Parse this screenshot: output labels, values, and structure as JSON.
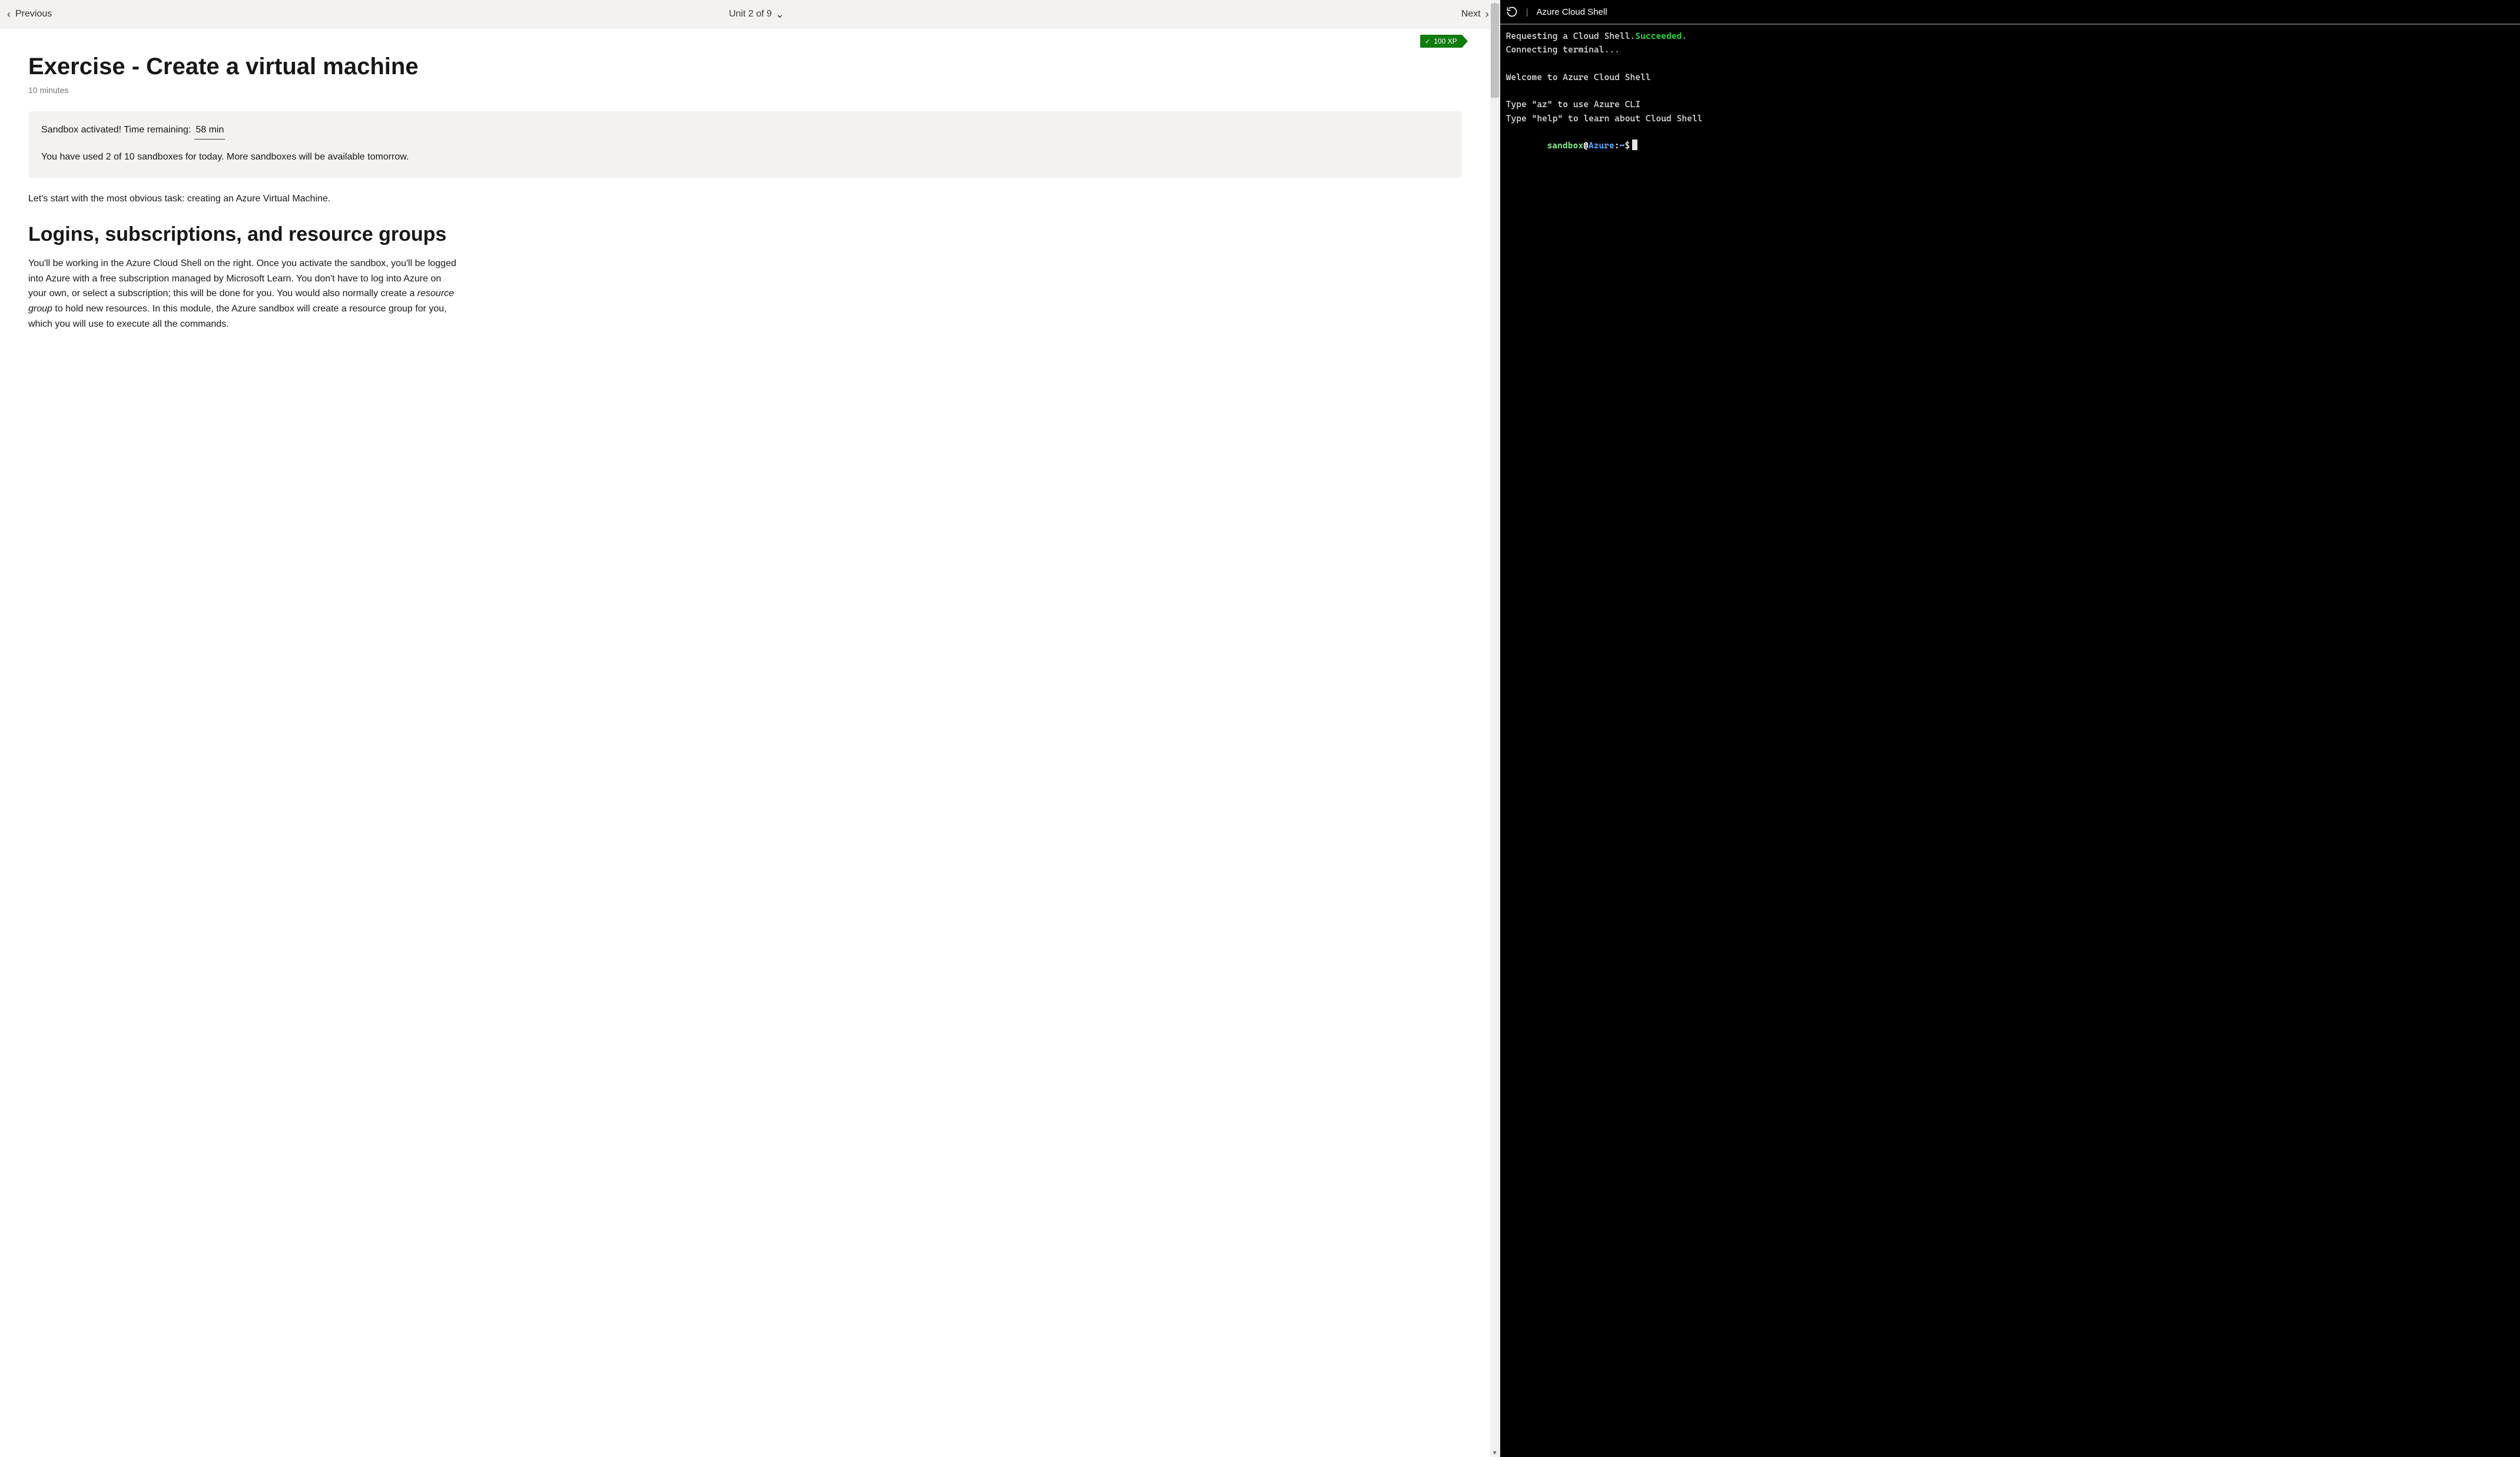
{
  "nav": {
    "prev_label": "Previous",
    "next_label": "Next",
    "unit_label": "Unit 2 of 9"
  },
  "xp_badge": {
    "label": "100 XP"
  },
  "page": {
    "title": "Exercise - Create a virtual machine",
    "time_estimate": "10 minutes"
  },
  "sandbox": {
    "activated_prefix": "Sandbox activated! Time remaining:",
    "time_remaining": "58 min",
    "usage_text": "You have used 2 of 10 sandboxes for today. More sandboxes will be available tomorrow."
  },
  "lead_text": "Let's start with the most obvious task: creating an Azure Virtual Machine.",
  "section1": {
    "heading": "Logins, subscriptions, and resource groups",
    "body_pre": "You'll be working in the Azure Cloud Shell on the right. Once you activate the sandbox, you'll be logged into Azure with a free subscription managed by Microsoft Learn. You don't have to log into Azure on your own, or select a subscription; this will be done for you. You would also normally create a ",
    "body_em": "resource group",
    "body_post": " to hold new resources. In this module, the Azure sandbox will create a resource group for you, which you will use to execute all the commands."
  },
  "terminal": {
    "title": "Azure Cloud Shell",
    "line1_a": "Requesting a Cloud Shell.",
    "line1_b": "Succeeded.",
    "line2": "Connecting terminal...",
    "welcome": "Welcome to Azure Cloud Shell",
    "tip1": "Type \"az\" to use Azure CLI",
    "tip2": "Type \"help\" to learn about Cloud Shell",
    "prompt_sandbox": "sandbox",
    "prompt_at": "@",
    "prompt_azure": "Azure",
    "prompt_colon": ":",
    "prompt_tilde": "~",
    "prompt_dollar": "$"
  }
}
